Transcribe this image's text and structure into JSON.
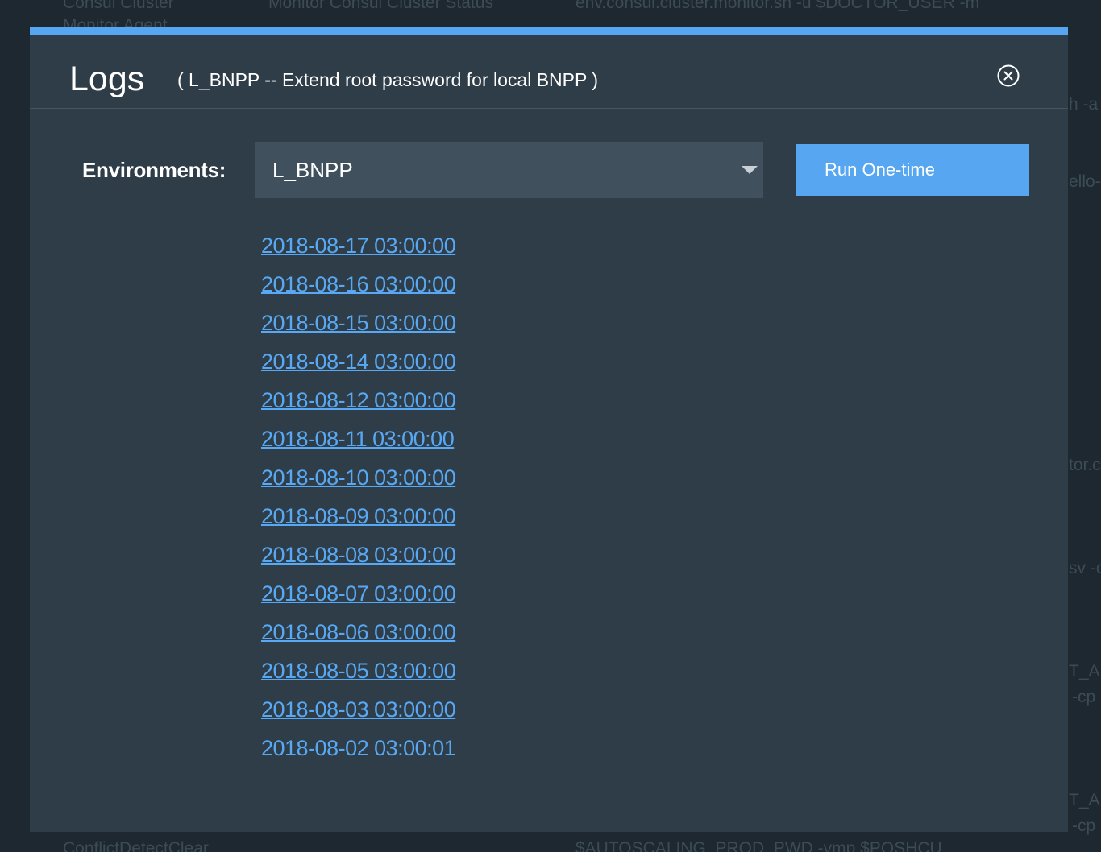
{
  "background": {
    "texts": [
      "Consul Cluster",
      "Monitor Agent",
      "Monitor Consul Cluster Status",
      "env.consul.cluster.monitor.sh -u $DOCTOR_USER -m",
      "h -a",
      "ello-",
      "tor.c",
      "sv -c",
      "T_AF",
      "-cp",
      "T_AF",
      "-cp",
      "ConflictDetectClear",
      "$AUTOSCALING_PROD_PWD -vmp $POSHCU"
    ]
  },
  "modal": {
    "accent_color": "#56a6f2",
    "title": "Logs",
    "subtitle": "( L_BNPP -- Extend root password for local BNPP )",
    "close_icon": "close-circle-icon",
    "environments_label": "Environments:",
    "environment_selected": "L_BNPP",
    "run_button_label": "Run One-time",
    "logs": [
      {
        "label": "2018-08-17 03:00:00",
        "link": true
      },
      {
        "label": "2018-08-16 03:00:00",
        "link": true
      },
      {
        "label": "2018-08-15 03:00:00",
        "link": true
      },
      {
        "label": "2018-08-14 03:00:00",
        "link": true
      },
      {
        "label": "2018-08-12 03:00:00",
        "link": true
      },
      {
        "label": "2018-08-11 03:00:00",
        "link": true
      },
      {
        "label": "2018-08-10 03:00:00",
        "link": true
      },
      {
        "label": "2018-08-09 03:00:00",
        "link": true
      },
      {
        "label": "2018-08-08 03:00:00",
        "link": true
      },
      {
        "label": "2018-08-07 03:00:00",
        "link": true
      },
      {
        "label": "2018-08-06 03:00:00",
        "link": true
      },
      {
        "label": "2018-08-05 03:00:00",
        "link": true
      },
      {
        "label": "2018-08-03 03:00:00",
        "link": true
      },
      {
        "label": "2018-08-02 03:00:01",
        "link": false
      }
    ]
  }
}
